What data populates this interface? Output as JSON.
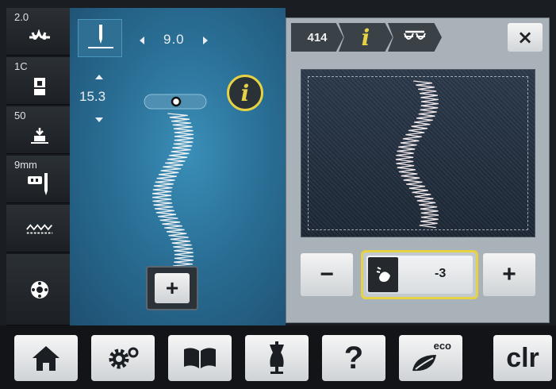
{
  "sidebar": {
    "items": [
      {
        "value": "2.0",
        "icon": "upper-thread-tension-icon"
      },
      {
        "value": "1C",
        "icon": "presser-foot-icon"
      },
      {
        "value": "50",
        "icon": "presser-foot-pressure-icon"
      },
      {
        "value": "9mm",
        "icon": "needle-plate-icon"
      },
      {
        "value": "",
        "icon": "feed-dog-icon"
      },
      {
        "value": "",
        "icon": "bobbin-icon"
      }
    ]
  },
  "stitch": {
    "width_value": "9.0",
    "length_value": "15.3",
    "needle_position_icon": "needle-position-icon",
    "info_label": "i",
    "add_label": "+"
  },
  "panel": {
    "tabs": {
      "number": "414",
      "info": "i",
      "balance_icon": "balance-icon"
    },
    "close_label": "×",
    "minus_label": "−",
    "plus_label": "+",
    "value": "-3",
    "value_icon": "fabric-feed-icon"
  },
  "bottom_bar": {
    "buttons": [
      {
        "name": "home",
        "icon": "home-icon"
      },
      {
        "name": "setup",
        "icon": "settings-icon"
      },
      {
        "name": "tutorial",
        "icon": "book-icon"
      },
      {
        "name": "consultant",
        "icon": "dress-form-icon"
      },
      {
        "name": "help",
        "label": "?"
      },
      {
        "name": "eco",
        "label": "eco",
        "icon": "leaf-icon"
      },
      {
        "name": "clear",
        "label": "clr"
      }
    ]
  },
  "colors": {
    "accent_yellow": "#e6d245",
    "stitch_bg": "#2a6f96",
    "panel_bg": "#a9b2b9"
  }
}
